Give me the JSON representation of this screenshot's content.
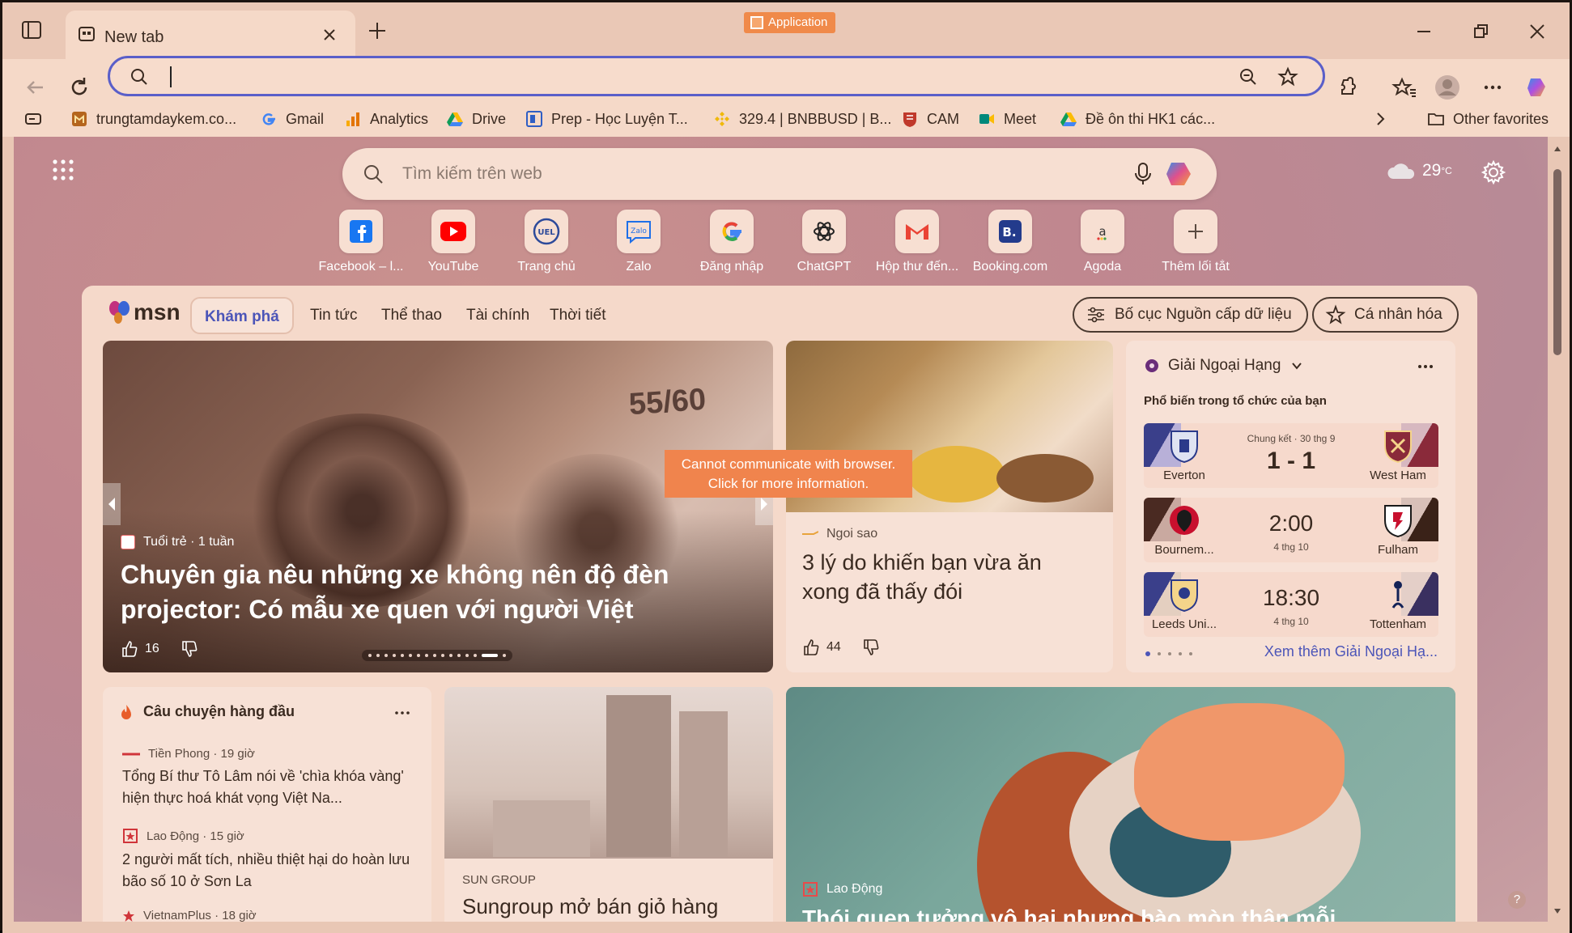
{
  "browser": {
    "tab_title": "New tab",
    "app_badge": "Application",
    "omnibox_value": "",
    "favorites": [
      {
        "label": "trungtamdaykem.co...",
        "icon": "site-favicon"
      },
      {
        "label": "Gmail",
        "icon": "google-icon"
      },
      {
        "label": "Analytics",
        "icon": "analytics-icon"
      },
      {
        "label": "Drive",
        "icon": "drive-icon"
      },
      {
        "label": "Prep - Học Luyện T...",
        "icon": "prep-icon"
      },
      {
        "label": "329.4 | BNBBUSD | B...",
        "icon": "binance-icon"
      },
      {
        "label": "CAM",
        "icon": "cam-icon"
      },
      {
        "label": "Meet",
        "icon": "meet-icon"
      },
      {
        "label": "Đề ôn thi HK1 các...",
        "icon": "drive-icon"
      }
    ],
    "other_favorites": "Other favorites"
  },
  "newtab": {
    "search_placeholder": "Tìm kiếm trên web",
    "weather_temp": "29",
    "weather_unit": "°C",
    "shortcuts": [
      {
        "label": "Facebook – l...",
        "icon": "facebook-icon"
      },
      {
        "label": "YouTube",
        "icon": "youtube-icon"
      },
      {
        "label": "Trang chủ",
        "icon": "ueh-icon"
      },
      {
        "label": "Zalo",
        "icon": "zalo-icon"
      },
      {
        "label": "Đăng nhập",
        "icon": "google-icon"
      },
      {
        "label": "ChatGPT",
        "icon": "chatgpt-icon"
      },
      {
        "label": "Hộp thư đến...",
        "icon": "gmail-icon"
      },
      {
        "label": "Booking.com",
        "icon": "booking-icon"
      },
      {
        "label": "Agoda",
        "icon": "agoda-icon"
      },
      {
        "label": "Thêm lối tắt",
        "icon": "plus-icon"
      }
    ]
  },
  "feed": {
    "logo": "msn",
    "nav": [
      "Khám phá",
      "Tin tức",
      "Thể thao",
      "Tài chính",
      "Thời tiết"
    ],
    "layout_btn": "Bố cục Nguồn cấp dữ liệu",
    "personalize_btn": "Cá nhân hóa",
    "hero": {
      "source": "Tuổi trẻ",
      "age": "1 tuần",
      "title": "Chuyên gia nêu những xe không nên độ đèn projector: Có mẫu xe quen với người Việt",
      "likes": "16",
      "sign_text": "55/60"
    },
    "card2": {
      "source": "Ngoi sao",
      "title": "3 lý do khiến bạn vừa ăn xong đã thấy đói",
      "likes": "44"
    },
    "sports": {
      "league": "Giải Ngoại Hạng",
      "subtitle": "Phổ biến trong tổ chức của bạn",
      "matches": [
        {
          "home": "Everton",
          "away": "West Ham",
          "meta": "Chung kết · 30 thg 9",
          "score": "1 - 1"
        },
        {
          "home": "Bournem...",
          "away": "Fulham",
          "meta": "4 thg 10",
          "score": "2:00"
        },
        {
          "home": "Leeds Uni...",
          "away": "Tottenham",
          "meta": "4 thg 10",
          "score": "18:30"
        }
      ],
      "more": "Xem thêm Giải Ngoại Hạ..."
    },
    "top_stories": {
      "title": "Câu chuyện hàng đầu",
      "items": [
        {
          "source": "Tiền Phong",
          "age": "19 giờ",
          "title": "Tổng Bí thư Tô Lâm nói về 'chìa khóa vàng' hiện thực hoá khát vọng Việt Na..."
        },
        {
          "source": "Lao Động",
          "age": "15 giờ",
          "title": "2 người mất tích, nhiều thiệt hại do hoàn lưu bão số 10 ở Sơn La"
        },
        {
          "source": "VietnamPlus",
          "age": "18 giờ",
          "title": ""
        }
      ]
    },
    "card_sun": {
      "source": "SUN GROUP",
      "title": "Sungroup mở bán giỏ hàng"
    },
    "card_big": {
      "source": "Lao Động",
      "title": "Thói quen tưởng vô hại nhưng bào mòn thận mỗi..."
    }
  },
  "toast": {
    "line1": "Cannot communicate with browser.",
    "line2": "Click for more information."
  }
}
